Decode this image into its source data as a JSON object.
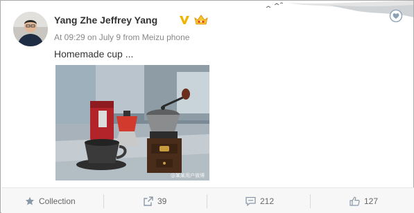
{
  "post": {
    "username": "Yang Zhe Jeffrey Yang",
    "meta": "At 09:29 on July 9 from Meizu phone",
    "text": "Homemade cup ...",
    "image_watermark": "@某某用户微博"
  },
  "badges": {
    "verified_icon": "verified-v-icon",
    "vip_icon": "vip-crown-icon"
  },
  "actions": {
    "collection_label": "Collection",
    "share_count": "39",
    "comment_count": "212",
    "like_count": "127"
  },
  "colors": {
    "accent": "#eb7350",
    "verified": "#f0b400",
    "text": "#333333",
    "muted": "#888888"
  }
}
